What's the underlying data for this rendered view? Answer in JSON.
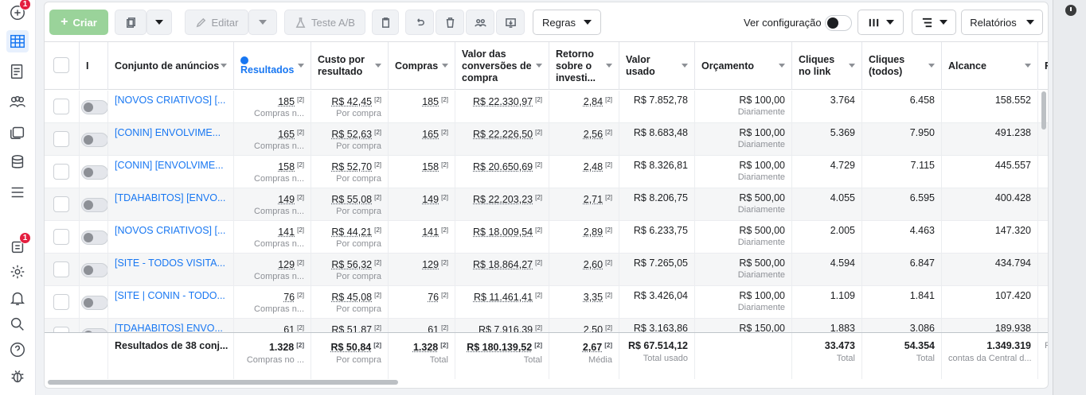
{
  "rail": {
    "badge_top": "1",
    "badge_mid": "1"
  },
  "toolbar": {
    "create_label": "Criar",
    "edit_label": "Editar",
    "ab_test_label": "Teste A/B",
    "rules_label": "Regras",
    "view_config_label": "Ver configuração",
    "reports_label": "Relatórios"
  },
  "table": {
    "headers": {
      "name": "Conjunto de anúncios",
      "results": "Resultados",
      "cost_per_result": "Custo por resultado",
      "purchases": "Compras",
      "conv_value": "Valor das conversões de compra",
      "roas": "Retorno sobre o investi...",
      "spent": "Valor usado",
      "budget": "Orçamento",
      "link_clicks": "Cliques no link",
      "clicks_all": "Cliques (todos)",
      "reach": "Alcance",
      "partial": "F",
      "col_i": "I"
    },
    "rows": [
      {
        "name": "[NOVOS CRIATIVOS] [...",
        "results": "185",
        "results_sub": "Compras n...",
        "cpr": "R$ 42,45",
        "cpr_sub": "Por compra",
        "purchases": "185",
        "conv": "R$ 22.330,97",
        "roas": "2,84",
        "spent": "R$ 7.852,78",
        "budget": "R$ 100,00",
        "budget_sub": "Diariamente",
        "link_clicks": "3.764",
        "clicks": "6.458",
        "reach": "158.552"
      },
      {
        "name": "[CONIN] ENVOLVIME...",
        "results": "165",
        "results_sub": "Compras n...",
        "cpr": "R$ 52,63",
        "cpr_sub": "Por compra",
        "purchases": "165",
        "conv": "R$ 22.226,50",
        "roas": "2,56",
        "spent": "R$ 8.683,48",
        "budget": "R$ 100,00",
        "budget_sub": "Diariamente",
        "link_clicks": "5.369",
        "clicks": "7.950",
        "reach": "491.238"
      },
      {
        "name": "[CONIN] [ENVOLVIME...",
        "results": "158",
        "results_sub": "Compras n...",
        "cpr": "R$ 52,70",
        "cpr_sub": "Por compra",
        "purchases": "158",
        "conv": "R$ 20.650,69",
        "roas": "2,48",
        "spent": "R$ 8.326,81",
        "budget": "R$ 100,00",
        "budget_sub": "Diariamente",
        "link_clicks": "4.729",
        "clicks": "7.115",
        "reach": "445.557"
      },
      {
        "name": "[TDAHABITOS] [ENVO...",
        "results": "149",
        "results_sub": "Compras n...",
        "cpr": "R$ 55,08",
        "cpr_sub": "Por compra",
        "purchases": "149",
        "conv": "R$ 22.203,23",
        "roas": "2,71",
        "spent": "R$ 8.206,75",
        "budget": "R$ 500,00",
        "budget_sub": "Diariamente",
        "link_clicks": "4.055",
        "clicks": "6.595",
        "reach": "400.428"
      },
      {
        "name": "[NOVOS CRIATIVOS] [...",
        "results": "141",
        "results_sub": "Compras n...",
        "cpr": "R$ 44,21",
        "cpr_sub": "Por compra",
        "purchases": "141",
        "conv": "R$ 18.009,54",
        "roas": "2,89",
        "spent": "R$ 6.233,75",
        "budget": "R$ 500,00",
        "budget_sub": "Diariamente",
        "link_clicks": "2.005",
        "clicks": "4.463",
        "reach": "147.320"
      },
      {
        "name": "[SITE - TODOS VISITA...",
        "results": "129",
        "results_sub": "Compras n...",
        "cpr": "R$ 56,32",
        "cpr_sub": "Por compra",
        "purchases": "129",
        "conv": "R$ 18.864,27",
        "roas": "2,60",
        "spent": "R$ 7.265,05",
        "budget": "R$ 500,00",
        "budget_sub": "Diariamente",
        "link_clicks": "4.594",
        "clicks": "6.847",
        "reach": "434.794"
      },
      {
        "name": "[SITE | CONIN - TODO...",
        "results": "76",
        "results_sub": "Compras n...",
        "cpr": "R$ 45,08",
        "cpr_sub": "Por compra",
        "purchases": "76",
        "conv": "R$ 11.461,41",
        "roas": "3,35",
        "spent": "R$ 3.426,04",
        "budget": "R$ 100,00",
        "budget_sub": "Diariamente",
        "link_clicks": "1.109",
        "clicks": "1.841",
        "reach": "107.420"
      },
      {
        "name": "[TDAHABITOS] ENVO...",
        "results": "61",
        "results_sub": "",
        "cpr": "R$ 51,87",
        "cpr_sub": "",
        "purchases": "61",
        "conv": "R$ 7.916,39",
        "roas": "2,50",
        "spent": "R$ 3.163,86",
        "budget": "R$ 150,00",
        "budget_sub": "",
        "link_clicks": "1.883",
        "clicks": "3.086",
        "reach": "189.938"
      }
    ],
    "footnote_marker": "[2]",
    "footer": {
      "label": "Resultados de 38 conj...",
      "results": "1.328",
      "results_sub": "Compras no ...",
      "cpr": "R$ 50,84",
      "cpr_sub": "Por compra",
      "purchases": "1.328",
      "purchases_sub": "Total",
      "conv": "R$ 180.139,52",
      "conv_sub": "Total",
      "roas": "2,67",
      "roas_sub": "Média",
      "spent": "R$ 67.514,12",
      "spent_sub": "Total usado",
      "link_clicks": "33.473",
      "link_clicks_sub": "Total",
      "clicks": "54.354",
      "clicks_sub": "Total",
      "reach": "1.349.319",
      "reach_sub": "contas da Central d...",
      "partial": "F"
    }
  }
}
